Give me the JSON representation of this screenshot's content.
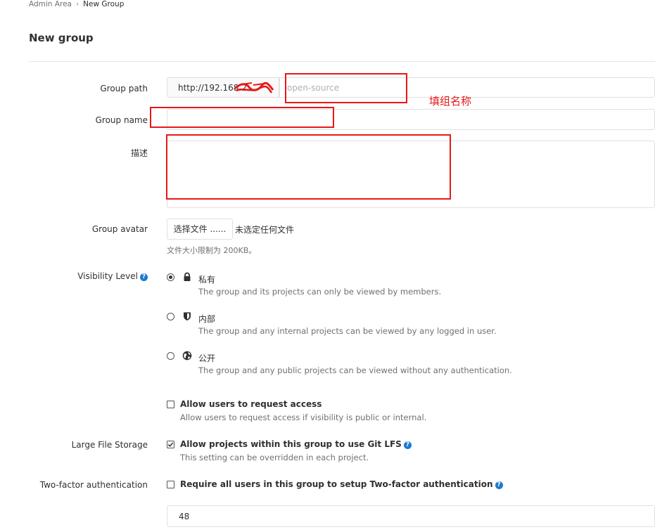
{
  "breadcrumb": {
    "parent": "Admin Area",
    "separator": "›",
    "current": "New Group"
  },
  "page_title": "New group",
  "form": {
    "group_path": {
      "label": "Group path",
      "prefix": "http://192.168.2",
      "placeholder": "open-source",
      "value": ""
    },
    "group_name": {
      "label": "Group name",
      "value": ""
    },
    "description": {
      "label": "描述",
      "value": ""
    },
    "avatar": {
      "label": "Group avatar",
      "button_label": "选择文件 ......",
      "status": "未选定任何文件",
      "help": "文件大小限制为 200KB。"
    },
    "visibility": {
      "label": "Visibility Level",
      "options": [
        {
          "title": "私有",
          "desc": "The group and its projects can only be viewed by members.",
          "icon": "lock-icon",
          "selected": true
        },
        {
          "title": "内部",
          "desc": "The group and any internal projects can be viewed by any logged in user.",
          "icon": "shield-icon",
          "selected": false
        },
        {
          "title": "公开",
          "desc": "The group and any public projects can be viewed without any authentication.",
          "icon": "globe-icon",
          "selected": false
        }
      ]
    },
    "request_access": {
      "title": "Allow users to request access",
      "desc": "Allow users to request access if visibility is public or internal.",
      "checked": false
    },
    "lfs": {
      "label": "Large File Storage",
      "title": "Allow projects within this group to use Git LFS",
      "desc": "This setting can be overridden in each project.",
      "checked": true
    },
    "two_factor": {
      "label": "Two-factor authentication",
      "title": "Require all users in this group to setup Two-factor authentication",
      "checked": false,
      "grace_period_value": "48"
    }
  },
  "annotation": {
    "text": "填组名称",
    "color": "#e81818"
  },
  "colors": {
    "accent": "#1f78d1",
    "annotation_red": "#e81818"
  }
}
